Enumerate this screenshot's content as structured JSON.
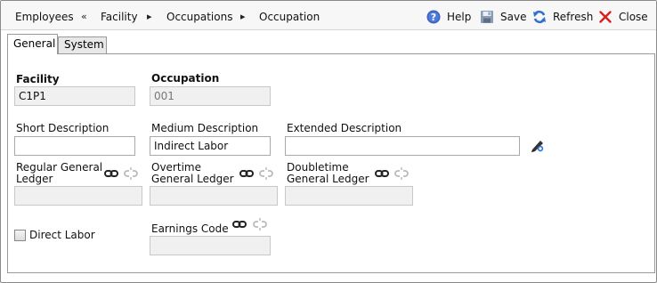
{
  "breadcrumb": [
    {
      "label": "Employees"
    },
    {
      "label": "Facility"
    },
    {
      "label": "Occupations"
    },
    {
      "label": "Occupation"
    }
  ],
  "breadcrumb_separators": [
    "«",
    "▸",
    "▸"
  ],
  "toolbar": {
    "help": "Help",
    "save": "Save",
    "refresh": "Refresh",
    "close": "Close"
  },
  "tabs": [
    {
      "label": "General",
      "active": true
    },
    {
      "label": "System",
      "active": false
    }
  ],
  "form": {
    "facility": {
      "label": "Facility",
      "value": "C1P1"
    },
    "occupation": {
      "label": "Occupation",
      "value": "001"
    },
    "short_description": {
      "label": "Short Description",
      "value": ""
    },
    "medium_description": {
      "label": "Medium Description",
      "value": "Indirect Labor"
    },
    "extended_description": {
      "label": "Extended Description",
      "value": ""
    },
    "regular_gl": {
      "label_line1": "Regular General",
      "label_line2": "Ledger",
      "value": ""
    },
    "overtime_gl": {
      "label_line1": "Overtime",
      "label_line2": "General Ledger",
      "value": ""
    },
    "doubletime_gl": {
      "label_line1": "Doubletime",
      "label_line2": "General Ledger",
      "value": ""
    },
    "direct_labor": {
      "label": "Direct Labor",
      "checked": false
    },
    "earnings_code": {
      "label": "Earnings Code",
      "value": ""
    }
  },
  "icons": {
    "help": "help-icon",
    "save": "save-icon",
    "refresh": "refresh-icon",
    "close": "close-icon",
    "link": "link-icon",
    "unlink": "unlink-icon",
    "edit": "edit-pen-icon"
  },
  "colors": {
    "help_blue": "#3a5fbf",
    "refresh_blue": "#2f6fd0",
    "close_red": "#d6201c",
    "toolbar_bg": "#f7f7f7",
    "readonly_bg": "#f0f0f0"
  }
}
